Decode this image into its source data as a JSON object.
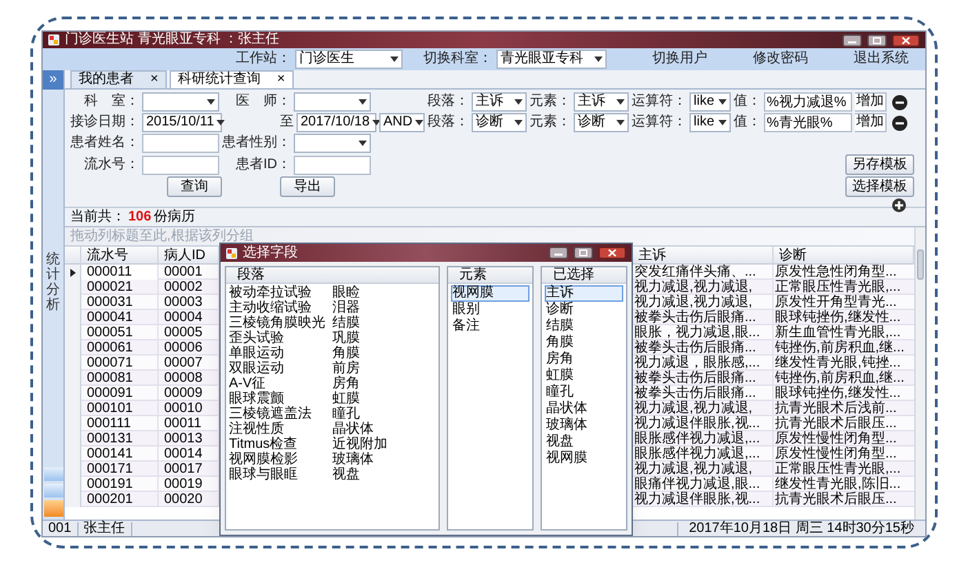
{
  "window": {
    "title": "门诊医生站  青光眼亚专科 ：张主任"
  },
  "top_bar": {
    "workstation_label": "工作站：",
    "workstation": "门诊医生",
    "department_label": "切换科室：",
    "department": "青光眼亚专科",
    "links": [
      "切换用户",
      "修改密码",
      "退出系统"
    ]
  },
  "sidebar": {
    "toggle": "»",
    "title": "统计分析"
  },
  "tabs": [
    {
      "label": "我的患者",
      "close": "×",
      "selected": false
    },
    {
      "label": "科研统计查询",
      "close": "×",
      "selected": true
    }
  ],
  "filters": {
    "department": {
      "label": "科　室："
    },
    "doctor": {
      "label": "医　师："
    },
    "visit_date": {
      "label": "接诊日期：",
      "from": "2015/10/11",
      "to_label": "至",
      "to": "2017/10/18"
    },
    "patient_name": {
      "label": "患者姓名："
    },
    "patient_sex": {
      "label": "患者性别："
    },
    "serial_no": {
      "label": "流水号："
    },
    "patient_id": {
      "label": "患者ID："
    }
  },
  "conditions": [
    {
      "paragraph_label": "段落：",
      "paragraph": "主诉",
      "element_label": "元素：",
      "element": "主诉",
      "operator_label": "运算符：",
      "operator": "like",
      "value_label": "值：",
      "value": "%视力减退%",
      "add": "增加"
    },
    {
      "join": "AND",
      "paragraph_label": "段落：",
      "paragraph": "诊断",
      "element_label": "元素：",
      "element": "诊断",
      "operator_label": "运算符：",
      "operator": "like",
      "value_label": "值：",
      "value": "%青光眼%",
      "add": "增加"
    }
  ],
  "buttons": {
    "query": "查询",
    "export": "导出",
    "save_template": "另存模板",
    "choose_template": "选择模板"
  },
  "result_summary": {
    "prefix": "当前共：",
    "count": "106",
    "suffix": "份病历"
  },
  "grid": {
    "group_hint": "拖动列标题至此,根据该列分组",
    "columns": [
      "流水号",
      "病人ID",
      "主诉",
      "诊断"
    ],
    "rows": [
      {
        "serial": "000011",
        "patient_id": "00001",
        "complaint": "突发红痛伴头痛、...",
        "diagnosis": "原发性急性闭角型...",
        "selected": true
      },
      {
        "serial": "000021",
        "patient_id": "00002",
        "complaint": "视力减退,视力减退,",
        "diagnosis": "正常眼压性青光眼,...",
        "selected": false
      },
      {
        "serial": "000031",
        "patient_id": "00003",
        "complaint": "视力减退,视力减退,",
        "diagnosis": "原发性开角型青光...",
        "selected": false
      },
      {
        "serial": "000041",
        "patient_id": "00004",
        "complaint": "被拳头击伤后眼痛...",
        "diagnosis": "眼球钝挫伤,继发性...",
        "selected": false
      },
      {
        "serial": "000051",
        "patient_id": "00005",
        "complaint": "眼胀，视力减退,眼...",
        "diagnosis": "新生血管性青光眼,...",
        "selected": false
      },
      {
        "serial": "000061",
        "patient_id": "00006",
        "complaint": "被拳头击伤后眼痛...",
        "diagnosis": "钝挫伤,前房积血,继...",
        "selected": false
      },
      {
        "serial": "000071",
        "patient_id": "00007",
        "complaint": "视力减退，眼胀感,...",
        "diagnosis": "继发性青光眼,钝挫...",
        "selected": false
      },
      {
        "serial": "000081",
        "patient_id": "00008",
        "complaint": "被拳头击伤后眼痛...",
        "diagnosis": "钝挫伤,前房积血,继...",
        "selected": false
      },
      {
        "serial": "000091",
        "patient_id": "00009",
        "complaint": "被拳头击伤后眼痛...",
        "diagnosis": "眼球钝挫伤,继发性...",
        "selected": false
      },
      {
        "serial": "000101",
        "patient_id": "00010",
        "complaint": "视力减退,视力减退,",
        "diagnosis": "抗青光眼术后浅前...",
        "selected": false
      },
      {
        "serial": "000111",
        "patient_id": "00011",
        "complaint": "视力减退伴眼胀,视...",
        "diagnosis": "抗青光眼术后眼压...",
        "selected": false
      },
      {
        "serial": "000131",
        "patient_id": "00013",
        "complaint": "眼胀感伴视力减退,...",
        "diagnosis": "原发性慢性闭角型...",
        "selected": false
      },
      {
        "serial": "000141",
        "patient_id": "00014",
        "complaint": "眼胀感伴视力减退,...",
        "diagnosis": "原发性慢性闭角型...",
        "selected": false
      },
      {
        "serial": "000171",
        "patient_id": "00017",
        "complaint": "视力减退,视力减退,",
        "diagnosis": "正常眼压性青光眼,...",
        "selected": false
      },
      {
        "serial": "000191",
        "patient_id": "00019",
        "complaint": "眼痛伴视力减退,眼...",
        "diagnosis": "继发性青光眼,陈旧...",
        "selected": false
      },
      {
        "serial": "000201",
        "patient_id": "00020",
        "complaint": "视力减退伴眼胀,视...",
        "diagnosis": "抗青光眼术后眼压...",
        "selected": false
      }
    ]
  },
  "dialog": {
    "title": "选择字段",
    "paragraphs": {
      "header": "段落",
      "items": [
        "被动牵拉试验",
        "主动收缩试验",
        "三棱镜角膜映光",
        "歪头试验",
        "单眼运动",
        "双眼运动",
        "A-V征",
        "眼球震颤",
        "三棱镜遮盖法",
        "注视性质",
        "Titmus检查",
        "视网膜检影",
        "眼球与眼眶",
        "眼睑",
        "泪器",
        "结膜",
        "巩膜",
        "角膜",
        "前房",
        "房角",
        "虹膜",
        "瞳孔",
        "晶状体",
        "近视附加",
        "玻璃体",
        "视盘"
      ]
    },
    "elements": {
      "header": "元素",
      "items": [
        {
          "label": "视网膜",
          "selected": true
        },
        {
          "label": "眼别",
          "selected": false
        },
        {
          "label": "备注",
          "selected": false
        }
      ]
    },
    "chosen": {
      "header": "已选择",
      "items": [
        {
          "label": "主诉",
          "selected": true
        },
        {
          "label": "诊断",
          "selected": false
        },
        {
          "label": "结膜",
          "selected": false
        },
        {
          "label": "角膜",
          "selected": false
        },
        {
          "label": "房角",
          "selected": false
        },
        {
          "label": "虹膜",
          "selected": false
        },
        {
          "label": "瞳孔",
          "selected": false
        },
        {
          "label": "晶状体",
          "selected": false
        },
        {
          "label": "玻璃体",
          "selected": false
        },
        {
          "label": "视盘",
          "selected": false
        },
        {
          "label": "视网膜",
          "selected": false
        }
      ]
    }
  },
  "status_bar": {
    "code": "001",
    "user": "张主任",
    "datetime": "2017年10月18日 周三 14时30分15秒"
  }
}
